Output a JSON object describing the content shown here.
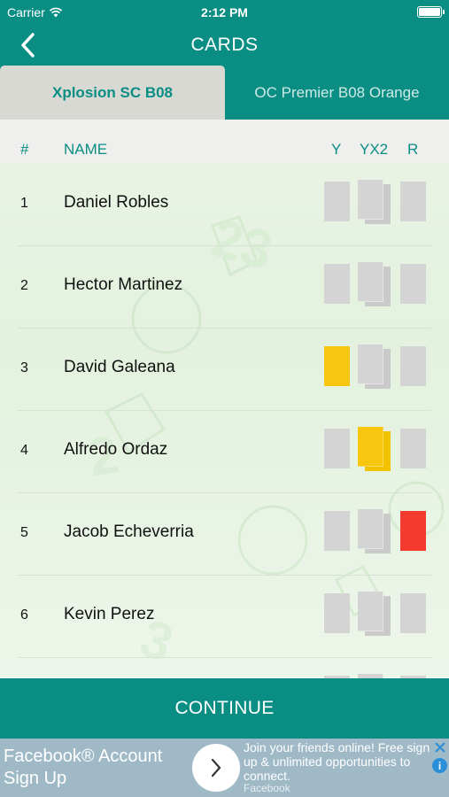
{
  "status_bar": {
    "carrier": "Carrier",
    "time": "2:12 PM"
  },
  "nav": {
    "title": "CARDS",
    "back_icon": "chevron-left-icon"
  },
  "tabs": [
    {
      "label": "Xplosion SC B08",
      "active": true
    },
    {
      "label": "OC Premier B08 Orange",
      "active": false
    }
  ],
  "columns": {
    "number": "#",
    "name": "NAME",
    "yellow": "Y",
    "double_yellow": "YX2",
    "red": "R"
  },
  "players": [
    {
      "number": "1",
      "name": "Daniel Robles",
      "yellow": false,
      "double_yellow": false,
      "red": false
    },
    {
      "number": "2",
      "name": "Hector Martinez",
      "yellow": false,
      "double_yellow": false,
      "red": false
    },
    {
      "number": "3",
      "name": "David Galeana",
      "yellow": true,
      "double_yellow": false,
      "red": false
    },
    {
      "number": "4",
      "name": "Alfredo Ordaz",
      "yellow": false,
      "double_yellow": true,
      "red": false
    },
    {
      "number": "5",
      "name": "Jacob Echeverria",
      "yellow": false,
      "double_yellow": false,
      "red": true
    },
    {
      "number": "6",
      "name": "Kevin Perez",
      "yellow": false,
      "double_yellow": false,
      "red": false
    }
  ],
  "colors": {
    "primary": "#0a8e83",
    "yellow_card": "#f7c710",
    "red_card": "#f43b2f",
    "inactive_card": "#d4d4d4"
  },
  "continue_label": "CONTINUE",
  "ad": {
    "title": "Facebook® Account Sign Up",
    "text": "Join your friends online! Free sign up & unlimited opportunities to connect.",
    "source": "Facebook",
    "info": "i"
  }
}
